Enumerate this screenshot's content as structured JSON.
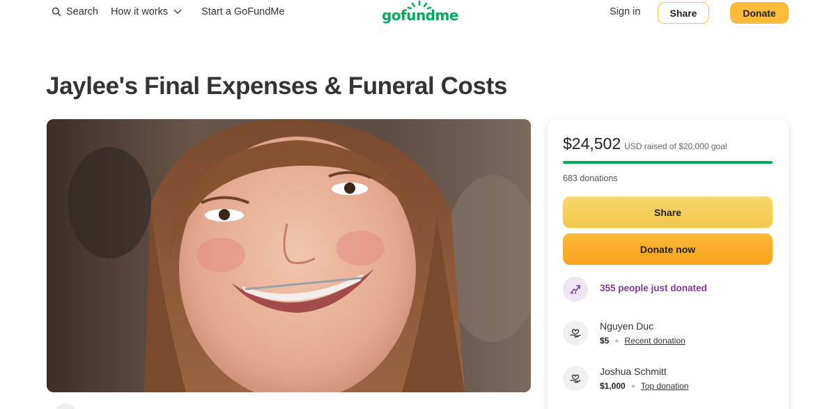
{
  "header": {
    "search_label": "Search",
    "how_it_works_label": "How it works",
    "start_label": "Start a GoFundMe",
    "logo_text": "gofundme",
    "signin_label": "Sign in",
    "share_label": "Share",
    "donate_label": "Donate"
  },
  "campaign": {
    "title": "Jaylee's Final Expenses & Funeral Costs"
  },
  "sidebar": {
    "raised_amount": "$24,502",
    "raised_label": "USD raised of $20,000 goal",
    "progress_fraction": 1.0,
    "donations_count": "683 donations",
    "share_button": "Share",
    "donate_button": "Donate now",
    "just_donated": "355 people just donated",
    "donors": [
      {
        "name": "Nguyen Duc",
        "amount": "$5",
        "tag": "Recent donation"
      },
      {
        "name": "Joshua Schmitt",
        "amount": "$1,000",
        "tag": "Top donation"
      }
    ]
  },
  "colors": {
    "brand_green": "#02a95c",
    "donate_orange": "#fdbb3a",
    "share_yellow": "#f5c542",
    "accent_purple": "#7a3d91"
  },
  "icons": [
    "search-icon",
    "chevron-down-icon",
    "logo-sun-icon",
    "trending-up-icon",
    "heart-hand-icon"
  ]
}
